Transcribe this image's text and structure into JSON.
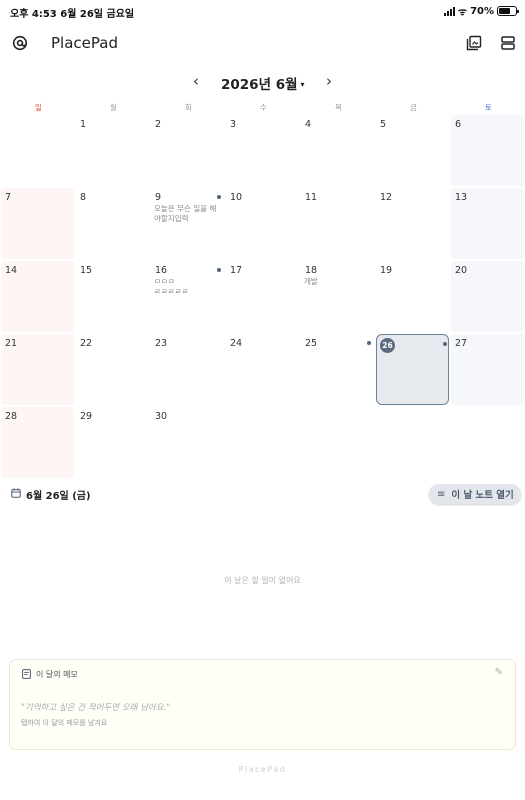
{
  "status_bar": {
    "time_date": "오후 4:53  6월 26일 금요일",
    "battery": "70%",
    "battery_level": 0.7,
    "icons": [
      "signal-icon",
      "wifi-icon",
      "battery-icon"
    ]
  },
  "header": {
    "app_title": "PlacePad",
    "icons": [
      "at-sign-icon",
      "gallery-icon",
      "layout-icon"
    ]
  },
  "calendar": {
    "month_label": "2026년 6월",
    "caret": "▾",
    "prev": "‹",
    "next": "›",
    "weekdays": [
      "일",
      "월",
      "화",
      "수",
      "목",
      "금",
      "토"
    ],
    "weekday_colors": {
      "sunday": "#e0453a",
      "saturday": "#3d79c6",
      "weekday": "#999999"
    },
    "first_weekday_index": 1,
    "days": [
      {
        "d": "1"
      },
      {
        "d": "2"
      },
      {
        "d": "3"
      },
      {
        "d": "4"
      },
      {
        "d": "5"
      },
      {
        "d": "6"
      },
      {
        "d": "7"
      },
      {
        "d": "8"
      },
      {
        "d": "9",
        "note": "오늘은 무슨 일을 해야할지입력",
        "dot": true
      },
      {
        "d": "10"
      },
      {
        "d": "11"
      },
      {
        "d": "12"
      },
      {
        "d": "13"
      },
      {
        "d": "14"
      },
      {
        "d": "15"
      },
      {
        "d": "16",
        "note": "ㅁㅁㅁ\nㄹㄹㄹㄹㄹ",
        "dot": true
      },
      {
        "d": "17"
      },
      {
        "d": "18",
        "note": "개발"
      },
      {
        "d": "19"
      },
      {
        "d": "20"
      },
      {
        "d": "21"
      },
      {
        "d": "22"
      },
      {
        "d": "23"
      },
      {
        "d": "24"
      },
      {
        "d": "25",
        "dot": true
      },
      {
        "d": "26",
        "today": true,
        "dot": true
      },
      {
        "d": "27"
      },
      {
        "d": "28"
      },
      {
        "d": "29"
      },
      {
        "d": "30"
      }
    ]
  },
  "selected_day": {
    "label": "6월 26일 (금)",
    "open_note_button": "이 날 노트 열기",
    "empty_message": "이 날은 할 일이 없어요"
  },
  "monthly_memo": {
    "title": "이 달의 메모",
    "quote": "\"기억하고 싶은 건 적어두면 오래 남아요.\"",
    "hint": "탭하여 이 달의 메모를 남겨요"
  },
  "footer": {
    "brand": "PlacePad"
  }
}
